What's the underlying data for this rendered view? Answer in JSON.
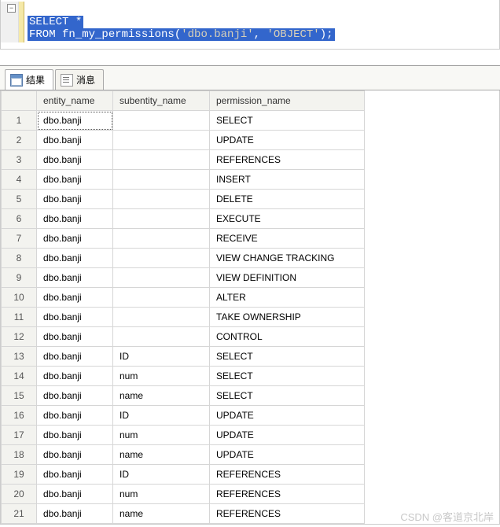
{
  "sql": {
    "line1_kw1": "SELECT",
    "line1_rest": " *",
    "line2_kw1": "FROM",
    "line2_func": " fn_my_permissions",
    "line2_paren_open": "(",
    "line2_str1": "'dbo.banji'",
    "line2_comma": ", ",
    "line2_str2": "'OBJECT'",
    "line2_close": ");"
  },
  "tabs": {
    "results": "结果",
    "messages": "消息"
  },
  "columns": {
    "entity": "entity_name",
    "subentity": "subentity_name",
    "permission": "permission_name"
  },
  "rows": [
    {
      "n": "1",
      "entity": "dbo.banji",
      "sub": "",
      "perm": "SELECT"
    },
    {
      "n": "2",
      "entity": "dbo.banji",
      "sub": "",
      "perm": "UPDATE"
    },
    {
      "n": "3",
      "entity": "dbo.banji",
      "sub": "",
      "perm": "REFERENCES"
    },
    {
      "n": "4",
      "entity": "dbo.banji",
      "sub": "",
      "perm": "INSERT"
    },
    {
      "n": "5",
      "entity": "dbo.banji",
      "sub": "",
      "perm": "DELETE"
    },
    {
      "n": "6",
      "entity": "dbo.banji",
      "sub": "",
      "perm": "EXECUTE"
    },
    {
      "n": "7",
      "entity": "dbo.banji",
      "sub": "",
      "perm": "RECEIVE"
    },
    {
      "n": "8",
      "entity": "dbo.banji",
      "sub": "",
      "perm": "VIEW CHANGE TRACKING"
    },
    {
      "n": "9",
      "entity": "dbo.banji",
      "sub": "",
      "perm": "VIEW DEFINITION"
    },
    {
      "n": "10",
      "entity": "dbo.banji",
      "sub": "",
      "perm": "ALTER"
    },
    {
      "n": "11",
      "entity": "dbo.banji",
      "sub": "",
      "perm": "TAKE OWNERSHIP"
    },
    {
      "n": "12",
      "entity": "dbo.banji",
      "sub": "",
      "perm": "CONTROL"
    },
    {
      "n": "13",
      "entity": "dbo.banji",
      "sub": "ID",
      "perm": "SELECT"
    },
    {
      "n": "14",
      "entity": "dbo.banji",
      "sub": "num",
      "perm": "SELECT"
    },
    {
      "n": "15",
      "entity": "dbo.banji",
      "sub": "name",
      "perm": "SELECT"
    },
    {
      "n": "16",
      "entity": "dbo.banji",
      "sub": "ID",
      "perm": "UPDATE"
    },
    {
      "n": "17",
      "entity": "dbo.banji",
      "sub": "num",
      "perm": "UPDATE"
    },
    {
      "n": "18",
      "entity": "dbo.banji",
      "sub": "name",
      "perm": "UPDATE"
    },
    {
      "n": "19",
      "entity": "dbo.banji",
      "sub": "ID",
      "perm": "REFERENCES"
    },
    {
      "n": "20",
      "entity": "dbo.banji",
      "sub": "num",
      "perm": "REFERENCES"
    },
    {
      "n": "21",
      "entity": "dbo.banji",
      "sub": "name",
      "perm": "REFERENCES"
    }
  ],
  "watermark": "CSDN @客道京北岸"
}
